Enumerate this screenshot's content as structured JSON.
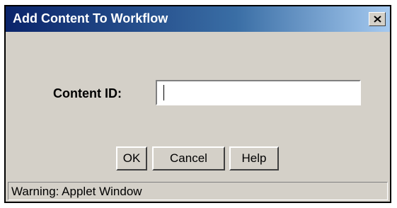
{
  "window": {
    "title": "Add Content To Workflow",
    "close_icon": "close-icon"
  },
  "form": {
    "content_id_label": "Content ID:",
    "content_id_value": "",
    "content_id_placeholder": ""
  },
  "buttons": {
    "ok_label": "OK",
    "cancel_label": "Cancel",
    "help_label": "Help"
  },
  "status": {
    "text": "Warning: Applet Window"
  },
  "colors": {
    "titlebar_start": "#0a246a",
    "titlebar_end": "#a6caf0",
    "dialog_background": "#d4d0c8"
  }
}
